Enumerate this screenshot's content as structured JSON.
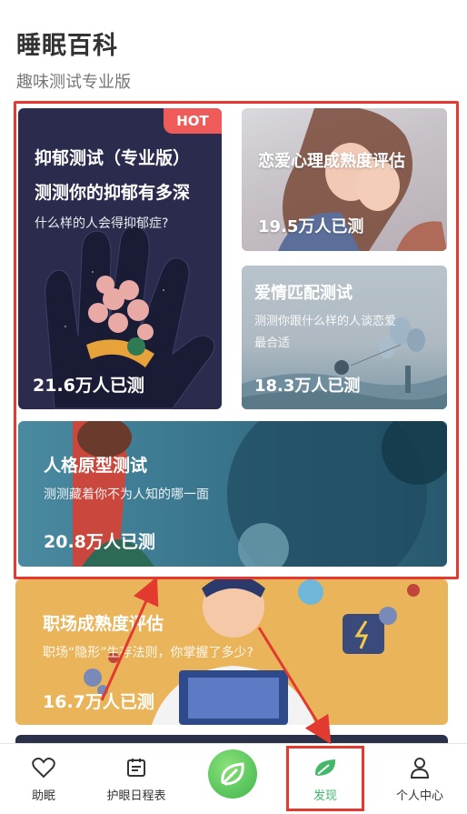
{
  "header": {
    "title": "睡眠百科",
    "subtitle": "趣味测试专业版"
  },
  "cards": {
    "depression": {
      "badge": "HOT",
      "title_line1": "抑郁测试（专业版）",
      "title_line2": "测测你的抑郁有多深",
      "desc": "什么样的人会得抑郁症?",
      "count": "21.6万人已测"
    },
    "love": {
      "title": "恋爱心理成熟度评估",
      "count": "19.5万人已测"
    },
    "match": {
      "title": "爱情匹配测试",
      "desc_line1": "测测你跟什么样的人谈恋爱",
      "desc_line2": "最合适",
      "count": "18.3万人已测"
    },
    "personality": {
      "title": "人格原型测试",
      "desc": "测测藏着你不为人知的哪一面",
      "count": "20.8万人已测"
    },
    "work": {
      "title": "职场成熟度评估",
      "desc": "职场“隐形”生存法则，你掌握了多少?",
      "count": "16.7万人已测"
    }
  },
  "tabbar": {
    "items": [
      {
        "id": "sleep",
        "label": "助眠",
        "icon": "heart-icon"
      },
      {
        "id": "schedule",
        "label": "护眼日程表",
        "icon": "calendar-icon"
      },
      {
        "id": "center",
        "label": "",
        "icon": "leaf-icon"
      },
      {
        "id": "discover",
        "label": "发现",
        "icon": "leaf-icon",
        "active": true
      },
      {
        "id": "profile",
        "label": "个人中心",
        "icon": "person-icon"
      }
    ]
  },
  "colors": {
    "accent": "#43b76a",
    "annotation": "#e23a2f",
    "hot": "#ef5b59"
  }
}
